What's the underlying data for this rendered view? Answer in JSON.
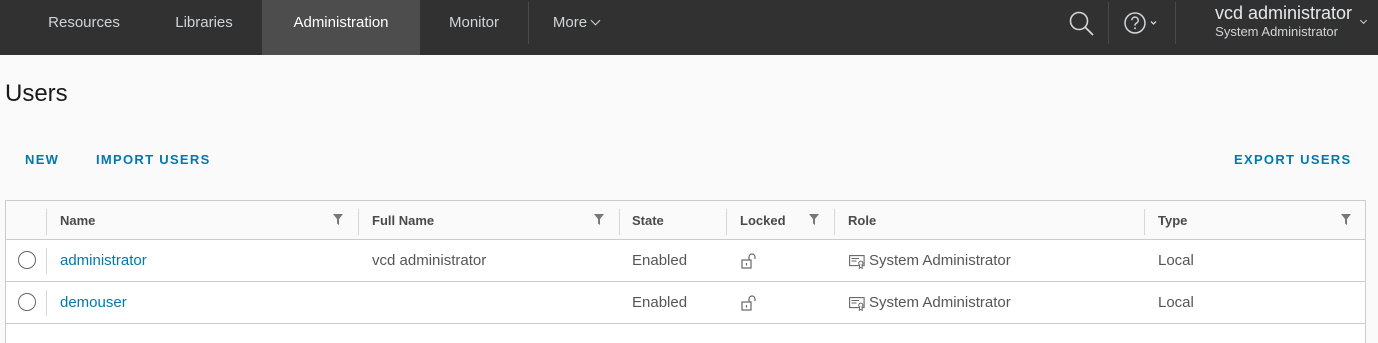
{
  "nav": {
    "tabs": [
      {
        "label": "Resources"
      },
      {
        "label": "Libraries"
      },
      {
        "label": "Administration"
      },
      {
        "label": "Monitor"
      }
    ],
    "more_label": "More",
    "user": {
      "name": "vcd administrator",
      "role": "System Administrator"
    }
  },
  "page": {
    "title": "Users",
    "actions": {
      "new": "NEW",
      "import": "IMPORT USERS",
      "export": "EXPORT USERS"
    }
  },
  "grid": {
    "columns": [
      "Name",
      "Full Name",
      "State",
      "Locked",
      "Role",
      "Type"
    ],
    "rows": [
      {
        "name": "administrator",
        "full_name": "vcd administrator",
        "state": "Enabled",
        "role": "System Administrator",
        "type": "Local"
      },
      {
        "name": "demouser",
        "full_name": "",
        "state": "Enabled",
        "role": "System Administrator",
        "type": "Local"
      }
    ]
  },
  "colors": {
    "nav_bg": "#313131",
    "nav_active": "#4d4d4d",
    "link": "#0079ad"
  }
}
